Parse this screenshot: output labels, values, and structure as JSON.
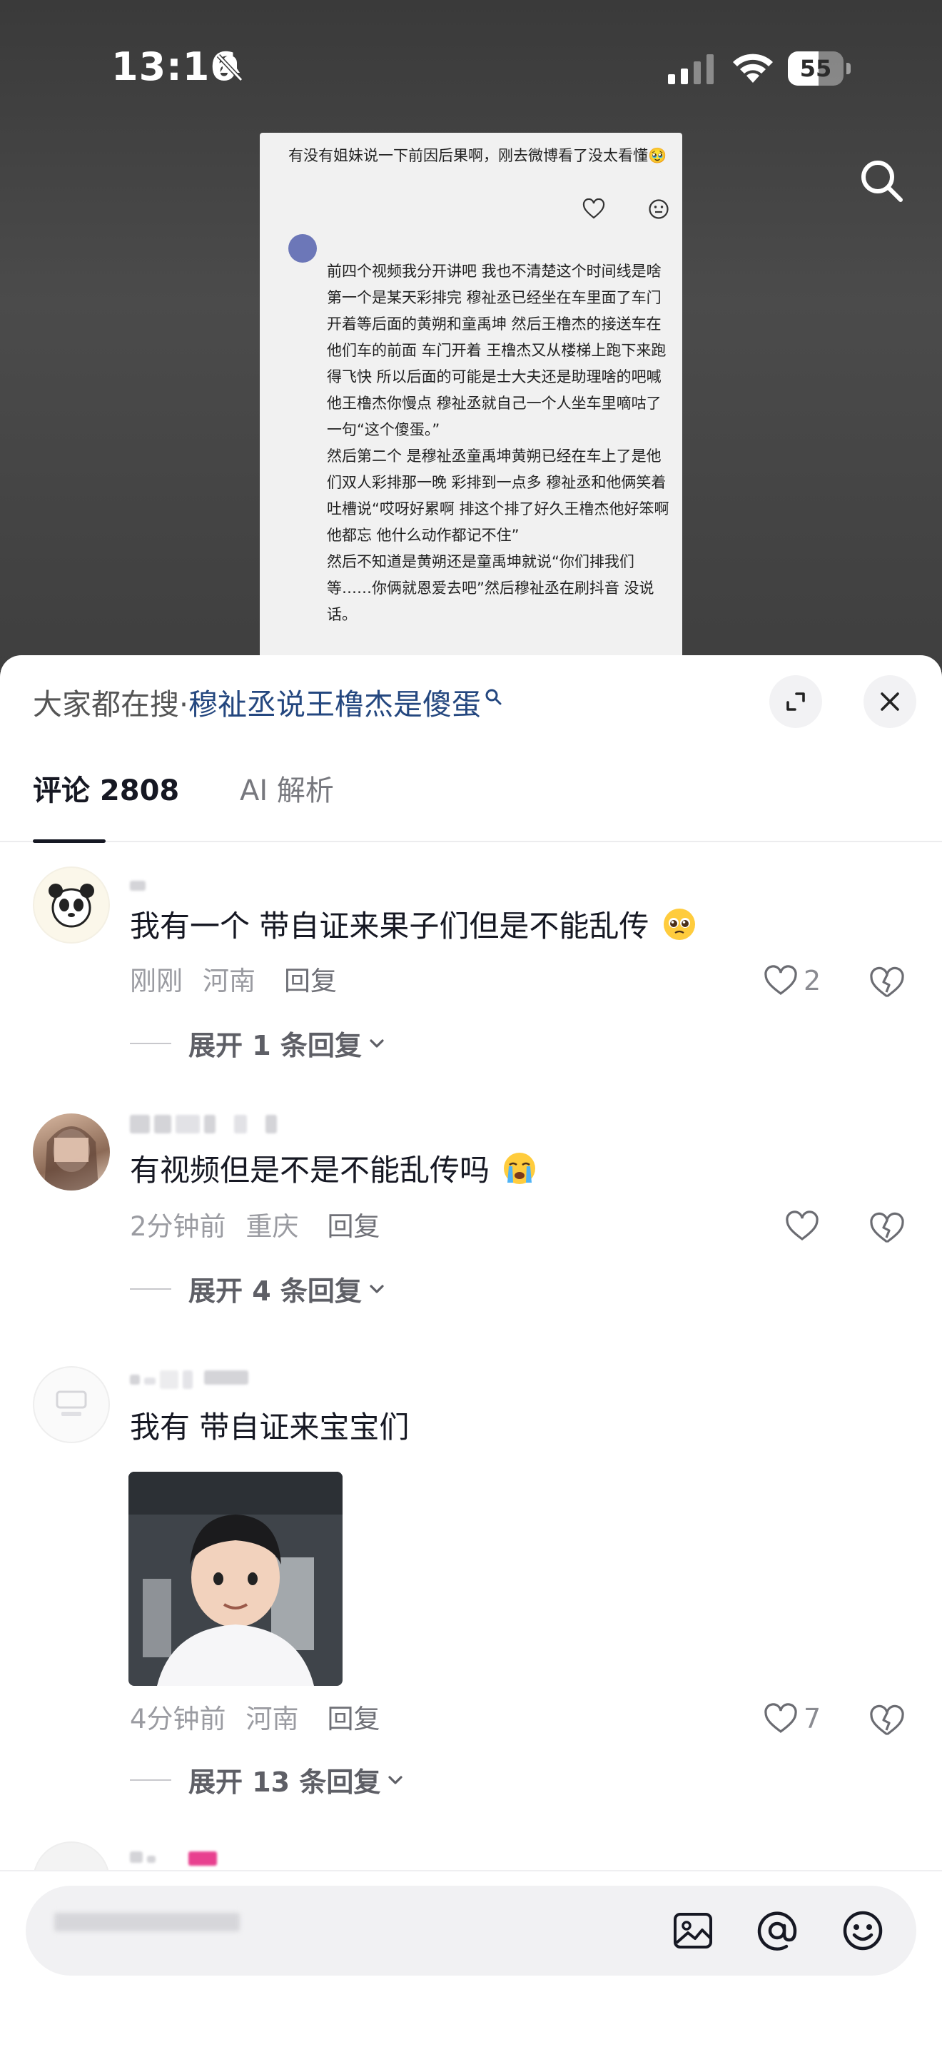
{
  "status_bar": {
    "time": "13:16",
    "battery_percent": "55",
    "battery_level": 0.55
  },
  "video": {
    "question": "有没有姐妹说一下前因后果啊，刚去微博看了没太看懂🥹",
    "answer": "前四个视频我分开讲吧 我也不清楚这个时间线是啥\n第一个是某天彩排完 穆祉丞已经坐在车里面了车门开着等后面的黄朔和童禹坤 然后王橹杰的接送车在他们车的前面 车门开着 王橹杰又从楼梯上跑下来跑得飞快 所以后面的可能是士大夫还是助理啥的吧喊他王橹杰你慢点 穆祉丞就自己一个人坐车里嘀咕了一句“这个傻蛋。”\n然后第二个 是穆祉丞童禹坤黄朔已经在车上了是他们双人彩排那一晚 彩排到一点多 穆祉丞和他俩笑着吐槽说“哎呀好累啊 排这个排了好久王橹杰他好笨啊 他都忘 他什么动作都记不住”\n然后不知道是黄朔还是童禹坤就说“你们排我们等……你俩就恩爱去吧”然后穆祉丞在刷抖音 没说话。"
  },
  "sheet": {
    "search_prefix": "大家都在搜·",
    "search_query": "穆祉丞说王橹杰是傻蛋",
    "tabs": [
      {
        "label": "评论 2808"
      },
      {
        "label": "AI 解析"
      }
    ]
  },
  "comments": [
    {
      "text": "我有一个 带自证来果子们但是不能乱传",
      "emoji": "🥹",
      "time": "刚刚",
      "location": "河南",
      "reply": "回复",
      "likes": "2",
      "expand": "展开 1 条回复"
    },
    {
      "text": "有视频但是不是不能乱传吗",
      "emoji": "😭",
      "time": "2分钟前",
      "location": "重庆",
      "reply": "回复",
      "likes": "",
      "expand": "展开 4 条回复"
    },
    {
      "text": "我有 带自证来宝宝们",
      "time": "4分钟前",
      "location": "河南",
      "reply": "回复",
      "likes": "7",
      "expand": "展开 13 条回复"
    }
  ],
  "colors": {
    "link_blue": "#24477f",
    "text_primary": "#161823",
    "text_secondary": "#9a9ba1"
  }
}
